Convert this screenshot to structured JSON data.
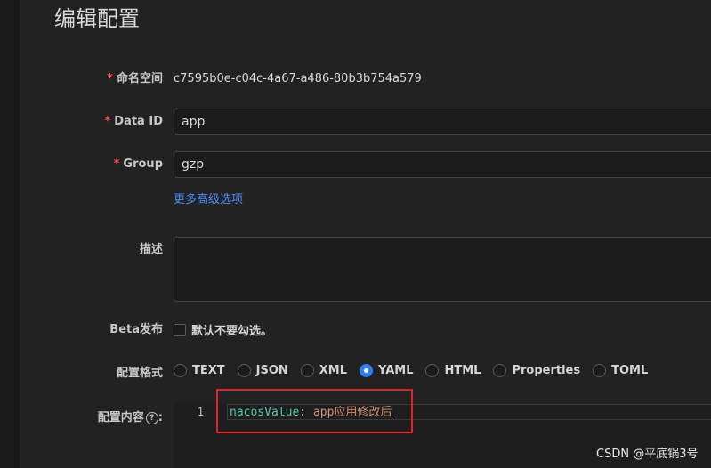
{
  "page": {
    "title": "编辑配置"
  },
  "form": {
    "namespace": {
      "label": "命名空间",
      "required_mark": "*",
      "value": "c7595b0e-c04c-4a67-a486-80b3b754a579"
    },
    "data_id": {
      "label": "Data ID",
      "required_mark": "*",
      "value": "app"
    },
    "group": {
      "label": "Group",
      "required_mark": "*",
      "value": "gzp"
    },
    "advanced_link": "更多高级选项",
    "description": {
      "label": "描述",
      "value": ""
    },
    "beta": {
      "label": "Beta发布",
      "checkbox_label": "默认不要勾选。",
      "checked": false
    },
    "format": {
      "label": "配置格式",
      "options": [
        "TEXT",
        "JSON",
        "XML",
        "YAML",
        "HTML",
        "Properties",
        "TOML"
      ],
      "selected": "YAML"
    },
    "content": {
      "label": "配置内容",
      "help_icon": "question-circle-icon",
      "line_number": "1",
      "code_key": "nacosValue",
      "code_sep": ": ",
      "code_value": "app应用修改后"
    }
  },
  "colors": {
    "accent": "#2f7df0",
    "link": "#4f8ef7",
    "required": "#ff4d4f",
    "annotation_box": "#e0242a"
  },
  "watermark": "CSDN @平底锅3号"
}
